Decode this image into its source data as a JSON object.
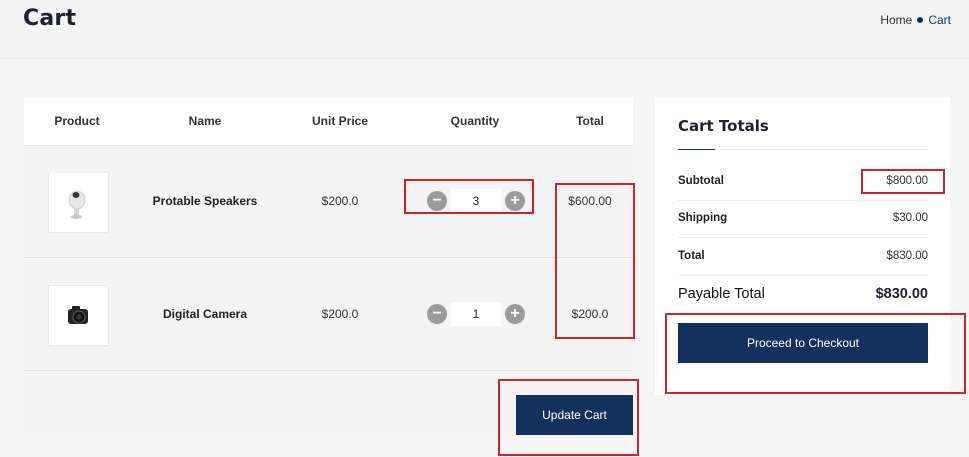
{
  "page": {
    "title": "Cart"
  },
  "breadcrumb": {
    "home": "Home",
    "current": "Cart"
  },
  "table": {
    "headers": [
      "Product",
      "Name",
      "Unit Price",
      "Quantity",
      "Total"
    ],
    "rows": [
      {
        "name": "Protable Speakers",
        "unit_price": "$200.0",
        "quantity": "3",
        "total": "$600.00",
        "image_icon": "speaker-icon"
      },
      {
        "name": "Digital Camera",
        "unit_price": "$200.0",
        "quantity": "1",
        "total": "$200.0",
        "image_icon": "camera-icon"
      }
    ],
    "qty_minus": "−",
    "qty_plus": "+"
  },
  "actions": {
    "update_cart": "Update Cart"
  },
  "totals": {
    "title": "Cart Totals",
    "subtotal_label": "Subtotal",
    "subtotal_value": "$800.00",
    "shipping_label": "Shipping",
    "shipping_value": "$30.00",
    "total_label": "Total",
    "total_value": "$830.00",
    "payable_label": "Payable Total",
    "payable_value": "$830.00",
    "checkout_label": "Proceed to Checkout"
  },
  "colors": {
    "accent": "#13315c",
    "highlight": "#c8262b",
    "qty_button": "#9b9b9b"
  }
}
